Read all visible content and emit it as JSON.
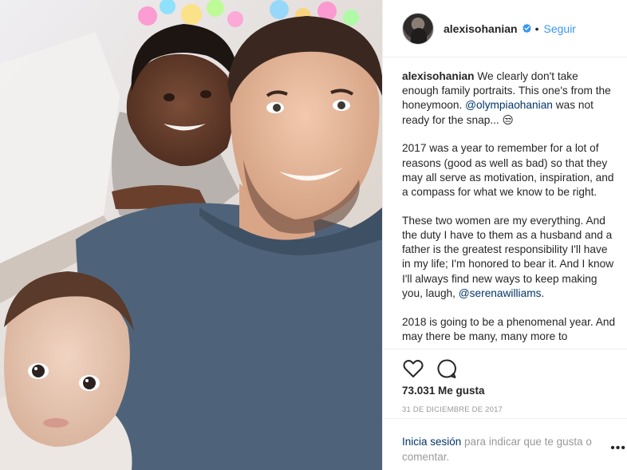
{
  "header": {
    "username": "alexisohanian",
    "separator": "•",
    "follow_label": "Seguir",
    "verified_icon": "verified-badge-icon"
  },
  "caption": {
    "username": "alexisohanian",
    "para1_text1": " We clearly don't take enough family portraits. This one's from the honeymoon. ",
    "para1_mention": "@olympiaohanian",
    "para1_text2": " was not ready for the snap... ",
    "para1_emoji": "😒",
    "para2": "2017 was a year to remember for a lot of reasons (good as well as bad) so that they may all serve as motivation, inspiration, and a compass for what we know to be right.",
    "para3_text": "These two women are my everything. And the duty I have to them as a husband and a father is the greatest responsibility I'll have in my life; I'm honored to bear it. And I know I'll always find new ways to keep making you, laugh, ",
    "para3_mention": "@serenawilliams",
    "para3_end": ".",
    "para4": "2018 is going to be a phenomenal year. And may there be many, many more to"
  },
  "actions": {
    "like_icon": "heart-icon",
    "comment_icon": "comment-icon"
  },
  "likes_text": "73.031 Me gusta",
  "date_text": "31 DE DICIEMBRE DE 2017",
  "comment_bar": {
    "login_link": "Inicia sesión",
    "login_rest": " para indicar que te gusta o comentar.",
    "more_label": "•••"
  },
  "colors": {
    "accent": "#3897f0",
    "text": "#262626",
    "muted": "#999999",
    "link": "#003569"
  }
}
